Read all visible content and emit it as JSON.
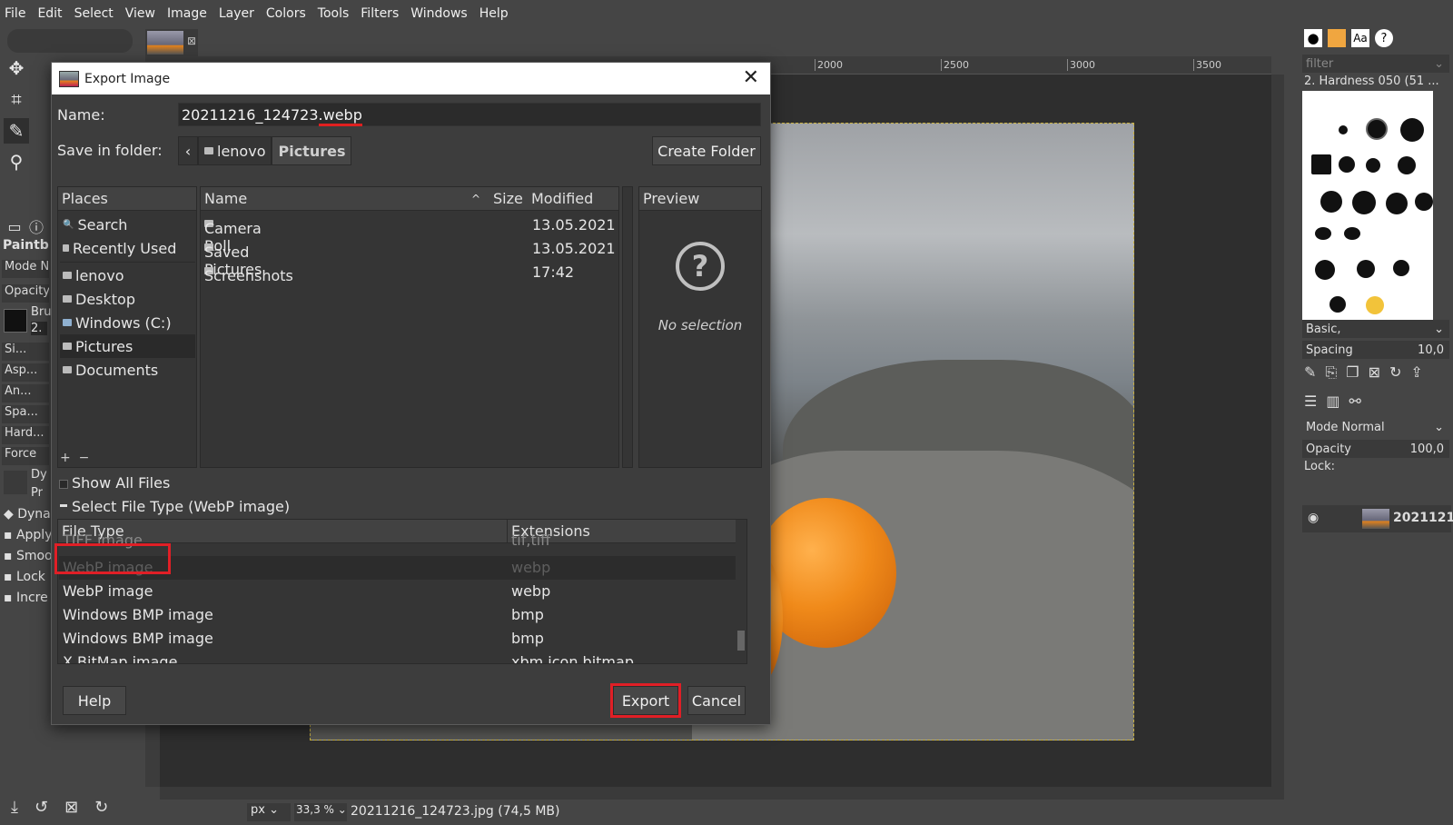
{
  "menubar": [
    "File",
    "Edit",
    "Select",
    "View",
    "Image",
    "Layer",
    "Colors",
    "Tools",
    "Filters",
    "Windows",
    "Help"
  ],
  "toolbox": {
    "paintbrush_label": "Paintb",
    "mode_label": "Mode N",
    "opacity_label": "Opacity",
    "brush_label": "Bru",
    "brush_value": "2.",
    "options": [
      "Si...",
      "Asp...",
      "An...",
      "Spa...",
      "Hard...",
      "Force"
    ],
    "dyn_label": "Dy",
    "pre_label": "Pr",
    "checks": [
      "Dyna",
      "Apply",
      "Smoo",
      "Lock",
      "Incre"
    ]
  },
  "ruler": [
    "2000",
    "2500",
    "3000",
    "3500"
  ],
  "status": {
    "unit": "px",
    "zoom": "33,3 %",
    "file": "20211216_124723.jpg (74,5 MB)"
  },
  "right_dock": {
    "filter_placeholder": "filter",
    "brush_name": "2. Hardness 050 (51 ...",
    "preset": "Basic,",
    "spacing_label": "Spacing",
    "spacing_value": "10,0",
    "mode": "Mode Normal",
    "opacity_label": "Opacity",
    "opacity_value": "100,0",
    "lock_label": "Lock:",
    "layer_name": "2021121"
  },
  "dialog": {
    "title": "Export Image",
    "name_label": "Name:",
    "name_base": "20211216_124723",
    "name_ext": ".webp",
    "folder_label": "Save in folder:",
    "crumbs": [
      "lenovo",
      "Pictures"
    ],
    "create_folder": "Create Folder",
    "places_header": "Places",
    "places": [
      "Search",
      "Recently Used",
      "lenovo",
      "Desktop",
      "Windows (C:)",
      "Pictures",
      "Documents"
    ],
    "columns": {
      "name": "Name",
      "size": "Size",
      "modified": "Modified"
    },
    "files": [
      {
        "name": "Camera Roll",
        "modified": "13.05.2021"
      },
      {
        "name": "Saved Pictures",
        "modified": "13.05.2021"
      },
      {
        "name": "Screenshots",
        "modified": "17:42"
      }
    ],
    "preview_header": "Preview",
    "no_selection": "No selection",
    "show_all": "Show All Files",
    "select_type": "Select File Type (WebP image)",
    "ft_columns": {
      "type": "File Type",
      "ext": "Extensions"
    },
    "filetypes": [
      {
        "type": "TIFF image",
        "ext": "tif,tiff"
      },
      {
        "type": "WebP image",
        "ext": "webp"
      },
      {
        "type": "WebP image",
        "ext": "webp"
      },
      {
        "type": "Windows BMP image",
        "ext": "bmp"
      },
      {
        "type": "Windows BMP image",
        "ext": "bmp"
      },
      {
        "type": "X BitMap image",
        "ext": "xbm,icon,bitmap"
      }
    ],
    "help": "Help",
    "export": "Export",
    "cancel": "Cancel"
  },
  "colors": {
    "highlight": "#e01f26"
  }
}
